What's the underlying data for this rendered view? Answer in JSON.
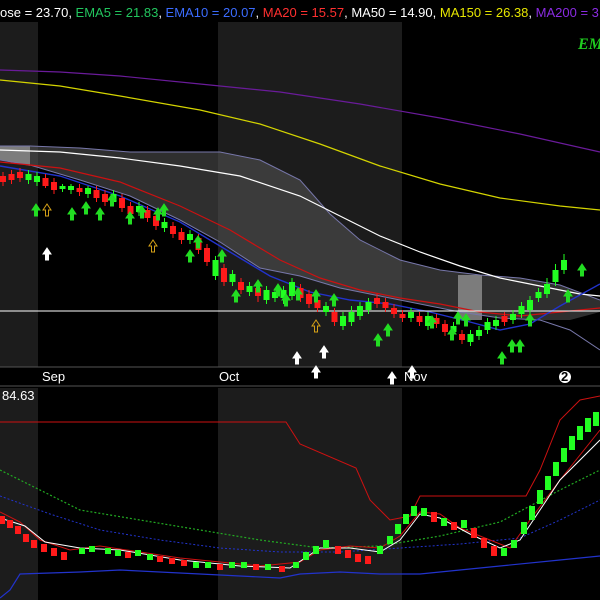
{
  "header": {
    "items": [
      {
        "text": "ose = 23.70",
        "color": "#ffffff"
      },
      {
        "text": ",",
        "color": "#ffffff"
      },
      {
        "text": " EMA5 = 21.83",
        "color": "#22c55e"
      },
      {
        "text": ",",
        "color": "#ffffff"
      },
      {
        "text": " EMA10 = 20.07",
        "color": "#3b6cff"
      },
      {
        "text": ",",
        "color": "#ffffff"
      },
      {
        "text": " MA20 = 15.57",
        "color": "#ff3030"
      },
      {
        "text": ",",
        "color": "#ffffff"
      },
      {
        "text": " MA50 = 14.90",
        "color": "#ffffff"
      },
      {
        "text": ",",
        "color": "#ffffff"
      },
      {
        "text": " MA150 = 26.38",
        "color": "#e6e600"
      },
      {
        "text": ",",
        "color": "#ffffff"
      },
      {
        "text": " MA200 = 3",
        "color": "#8a2be2"
      }
    ]
  },
  "corner_label": "EM",
  "x_axis_labels": [
    "Sep",
    "Oct",
    "Nov"
  ],
  "marker_badge": "2",
  "lower_panel_value": "84.63",
  "colors": {
    "background": "#000000",
    "shaded_band": "#1c1c1c",
    "up_candle": "#22ff22",
    "down_candle": "#ff1a1a",
    "ma150": "#d4d400",
    "ma200": "#6a1b9a",
    "ma50": "#ffffff",
    "ma20": "#cc1111",
    "ema10": "#2233cc",
    "envelope": "#7777aa",
    "cloud_fill": "#555555",
    "buy_arrow": "#22dd22",
    "hollow_arrow": "#d4a017",
    "white_arrow": "#ffffff",
    "horizontal_line": "#ffffff"
  },
  "chart_data": [
    {
      "type": "candlestick",
      "title": "",
      "series": [
        {
          "name": "MA150",
          "values": []
        },
        {
          "name": "MA200",
          "values": []
        },
        {
          "name": "MA50",
          "values": []
        },
        {
          "name": "MA20",
          "values": []
        },
        {
          "name": "EMA10",
          "values": []
        }
      ],
      "candles": [
        {
          "c": 0,
          "o": 176,
          "cl": 182,
          "hi": 172,
          "lo": 186,
          "up": false
        },
        {
          "c": 1,
          "o": 174,
          "cl": 180,
          "hi": 170,
          "lo": 184,
          "up": false
        },
        {
          "c": 2,
          "o": 172,
          "cl": 178,
          "hi": 168,
          "lo": 182,
          "up": false
        },
        {
          "c": 3,
          "o": 180,
          "cl": 174,
          "hi": 170,
          "lo": 184,
          "up": true
        },
        {
          "c": 4,
          "o": 182,
          "cl": 176,
          "hi": 172,
          "lo": 186,
          "up": true
        },
        {
          "c": 5,
          "o": 178,
          "cl": 186,
          "hi": 174,
          "lo": 188,
          "up": false
        },
        {
          "c": 6,
          "o": 182,
          "cl": 190,
          "hi": 178,
          "lo": 194,
          "up": false
        },
        {
          "c": 7,
          "o": 188,
          "cl": 186,
          "hi": 184,
          "lo": 192,
          "up": true
        },
        {
          "c": 8,
          "o": 190,
          "cl": 186,
          "hi": 184,
          "lo": 194,
          "up": true
        },
        {
          "c": 9,
          "o": 188,
          "cl": 192,
          "hi": 184,
          "lo": 196,
          "up": false
        },
        {
          "c": 10,
          "o": 194,
          "cl": 188,
          "hi": 186,
          "lo": 198,
          "up": true
        },
        {
          "c": 11,
          "o": 190,
          "cl": 198,
          "hi": 186,
          "lo": 202,
          "up": false
        },
        {
          "c": 12,
          "o": 194,
          "cl": 202,
          "hi": 190,
          "lo": 206,
          "up": false
        },
        {
          "c": 13,
          "o": 202,
          "cl": 194,
          "hi": 190,
          "lo": 206,
          "up": true
        },
        {
          "c": 14,
          "o": 198,
          "cl": 208,
          "hi": 194,
          "lo": 212,
          "up": false
        },
        {
          "c": 15,
          "o": 206,
          "cl": 214,
          "hi": 202,
          "lo": 218,
          "up": false
        },
        {
          "c": 16,
          "o": 212,
          "cl": 206,
          "hi": 202,
          "lo": 216,
          "up": true
        },
        {
          "c": 17,
          "o": 210,
          "cl": 218,
          "hi": 206,
          "lo": 222,
          "up": false
        },
        {
          "c": 18,
          "o": 216,
          "cl": 226,
          "hi": 212,
          "lo": 230,
          "up": false
        },
        {
          "c": 19,
          "o": 228,
          "cl": 222,
          "hi": 218,
          "lo": 232,
          "up": true
        },
        {
          "c": 20,
          "o": 226,
          "cl": 234,
          "hi": 222,
          "lo": 238,
          "up": false
        },
        {
          "c": 21,
          "o": 232,
          "cl": 240,
          "hi": 228,
          "lo": 244,
          "up": false
        },
        {
          "c": 22,
          "o": 240,
          "cl": 234,
          "hi": 230,
          "lo": 244,
          "up": true
        },
        {
          "c": 23,
          "o": 238,
          "cl": 250,
          "hi": 234,
          "lo": 254,
          "up": false
        },
        {
          "c": 24,
          "o": 248,
          "cl": 262,
          "hi": 244,
          "lo": 266,
          "up": false
        },
        {
          "c": 25,
          "o": 276,
          "cl": 260,
          "hi": 256,
          "lo": 280,
          "up": true
        },
        {
          "c": 26,
          "o": 268,
          "cl": 282,
          "hi": 264,
          "lo": 286,
          "up": false
        },
        {
          "c": 27,
          "o": 282,
          "cl": 274,
          "hi": 270,
          "lo": 286,
          "up": true
        },
        {
          "c": 28,
          "o": 282,
          "cl": 290,
          "hi": 278,
          "lo": 294,
          "up": false
        },
        {
          "c": 29,
          "o": 292,
          "cl": 286,
          "hi": 282,
          "lo": 296,
          "up": true
        },
        {
          "c": 30,
          "o": 288,
          "cl": 296,
          "hi": 284,
          "lo": 302,
          "up": false
        },
        {
          "c": 31,
          "o": 300,
          "cl": 290,
          "hi": 286,
          "lo": 304,
          "up": true
        },
        {
          "c": 32,
          "o": 298,
          "cl": 292,
          "hi": 288,
          "lo": 302,
          "up": true
        },
        {
          "c": 33,
          "o": 298,
          "cl": 290,
          "hi": 286,
          "lo": 304,
          "up": true
        },
        {
          "c": 34,
          "o": 296,
          "cl": 282,
          "hi": 278,
          "lo": 300,
          "up": true
        },
        {
          "c": 35,
          "o": 288,
          "cl": 298,
          "hi": 284,
          "lo": 302,
          "up": false
        },
        {
          "c": 36,
          "o": 294,
          "cl": 304,
          "hi": 290,
          "lo": 308,
          "up": false
        },
        {
          "c": 37,
          "o": 300,
          "cl": 308,
          "hi": 296,
          "lo": 312,
          "up": false
        },
        {
          "c": 38,
          "o": 312,
          "cl": 306,
          "hi": 302,
          "lo": 316,
          "up": true
        },
        {
          "c": 39,
          "o": 312,
          "cl": 322,
          "hi": 308,
          "lo": 326,
          "up": false
        },
        {
          "c": 40,
          "o": 326,
          "cl": 316,
          "hi": 312,
          "lo": 330,
          "up": true
        },
        {
          "c": 41,
          "o": 322,
          "cl": 312,
          "hi": 306,
          "lo": 326,
          "up": true
        },
        {
          "c": 42,
          "o": 316,
          "cl": 306,
          "hi": 302,
          "lo": 320,
          "up": true
        },
        {
          "c": 43,
          "o": 310,
          "cl": 302,
          "hi": 298,
          "lo": 314,
          "up": true
        },
        {
          "c": 44,
          "o": 298,
          "cl": 304,
          "hi": 294,
          "lo": 308,
          "up": false
        },
        {
          "c": 45,
          "o": 302,
          "cl": 308,
          "hi": 298,
          "lo": 312,
          "up": false
        },
        {
          "c": 46,
          "o": 308,
          "cl": 314,
          "hi": 304,
          "lo": 318,
          "up": false
        },
        {
          "c": 47,
          "o": 314,
          "cl": 318,
          "hi": 310,
          "lo": 322,
          "up": false
        },
        {
          "c": 48,
          "o": 318,
          "cl": 312,
          "hi": 308,
          "lo": 322,
          "up": true
        },
        {
          "c": 49,
          "o": 316,
          "cl": 322,
          "hi": 312,
          "lo": 326,
          "up": false
        },
        {
          "c": 50,
          "o": 326,
          "cl": 316,
          "hi": 312,
          "lo": 330,
          "up": true
        },
        {
          "c": 51,
          "o": 318,
          "cl": 324,
          "hi": 314,
          "lo": 328,
          "up": false
        },
        {
          "c": 52,
          "o": 324,
          "cl": 332,
          "hi": 320,
          "lo": 336,
          "up": false
        },
        {
          "c": 53,
          "o": 332,
          "cl": 326,
          "hi": 322,
          "lo": 338,
          "up": true
        },
        {
          "c": 54,
          "o": 334,
          "cl": 340,
          "hi": 330,
          "lo": 344,
          "up": false
        },
        {
          "c": 55,
          "o": 342,
          "cl": 334,
          "hi": 330,
          "lo": 346,
          "up": true
        },
        {
          "c": 56,
          "o": 336,
          "cl": 330,
          "hi": 326,
          "lo": 340,
          "up": true
        },
        {
          "c": 57,
          "o": 330,
          "cl": 322,
          "hi": 318,
          "lo": 334,
          "up": true
        },
        {
          "c": 58,
          "o": 326,
          "cl": 320,
          "hi": 316,
          "lo": 330,
          "up": true
        },
        {
          "c": 59,
          "o": 316,
          "cl": 322,
          "hi": 312,
          "lo": 326,
          "up": false
        },
        {
          "c": 60,
          "o": 320,
          "cl": 314,
          "hi": 310,
          "lo": 324,
          "up": true
        },
        {
          "c": 61,
          "o": 314,
          "cl": 306,
          "hi": 302,
          "lo": 318,
          "up": true
        },
        {
          "c": 62,
          "o": 310,
          "cl": 300,
          "hi": 296,
          "lo": 314,
          "up": true
        },
        {
          "c": 63,
          "o": 298,
          "cl": 292,
          "hi": 288,
          "lo": 302,
          "up": true
        },
        {
          "c": 64,
          "o": 294,
          "cl": 284,
          "hi": 278,
          "lo": 298,
          "up": true
        },
        {
          "c": 65,
          "o": 282,
          "cl": 270,
          "hi": 264,
          "lo": 286,
          "up": true
        },
        {
          "c": 66,
          "o": 270,
          "cl": 260,
          "hi": 254,
          "lo": 274,
          "up": true
        }
      ]
    }
  ]
}
